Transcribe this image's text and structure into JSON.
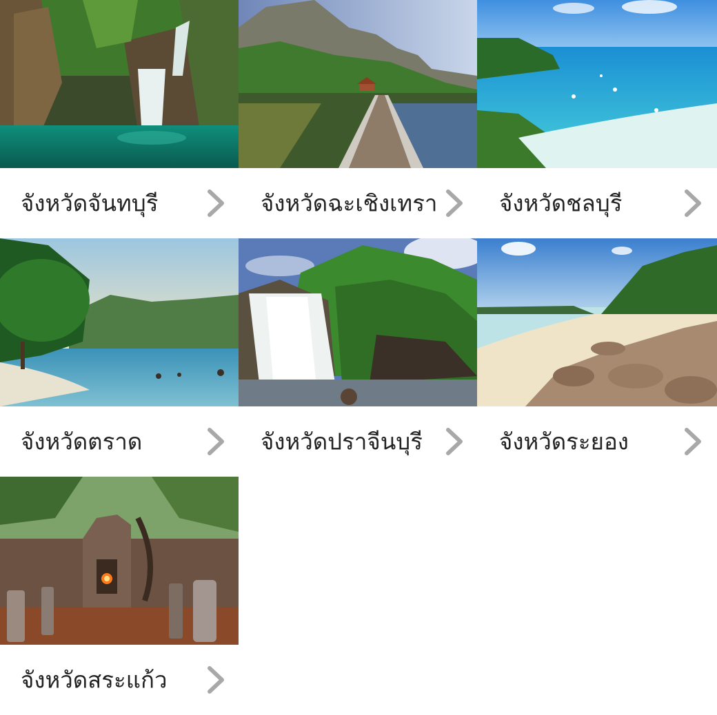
{
  "provinces": [
    {
      "label": "จังหวัดจันทบุรี",
      "scene": "waterfall-pool"
    },
    {
      "label": "จังหวัดฉะเชิงเทรา",
      "scene": "boardwalk-mountains"
    },
    {
      "label": "จังหวัดชลบุรี",
      "scene": "tropical-beach"
    },
    {
      "label": "จังหวัดตราด",
      "scene": "island-shore"
    },
    {
      "label": "จังหวัดปราจีนบุรี",
      "scene": "forest-waterfall"
    },
    {
      "label": "จังหวัดระยอง",
      "scene": "rocky-beach"
    },
    {
      "label": "จังหวัดสระแก้ว",
      "scene": "khmer-ruins"
    }
  ],
  "icons": {
    "arrow": "chevron-right-icon"
  },
  "colors": {
    "chevron": "#a8a8a8",
    "label": "#222222",
    "background": "#ffffff"
  }
}
